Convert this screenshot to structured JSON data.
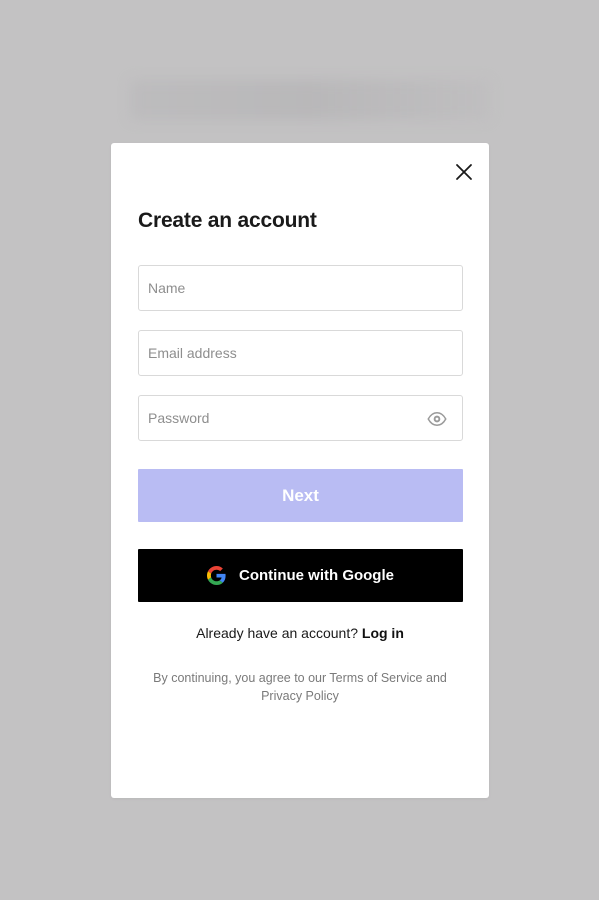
{
  "modal": {
    "title": "Create an account",
    "close_icon": "close-icon"
  },
  "form": {
    "name_placeholder": "Name",
    "email_placeholder": "Email address",
    "password_placeholder": "Password",
    "password_toggle_icon": "eye-icon",
    "next_label": "Next",
    "google_label": "Continue with Google",
    "google_icon": "google-logo-icon"
  },
  "login": {
    "prompt": "Already have an account?",
    "link_label": "Log in"
  },
  "legal": {
    "prefix": "By continuing, you agree to our",
    "terms_label": "Terms of Service",
    "conjunction": "and",
    "privacy_label": "Privacy Policy"
  },
  "colors": {
    "backdrop": "#c3c2c3",
    "modal_bg": "#ffffff",
    "next_button_disabled": "#b9bcf3",
    "google_button_bg": "#000000",
    "field_border": "#d9d9d9",
    "muted_text": "#7a7a7a"
  }
}
